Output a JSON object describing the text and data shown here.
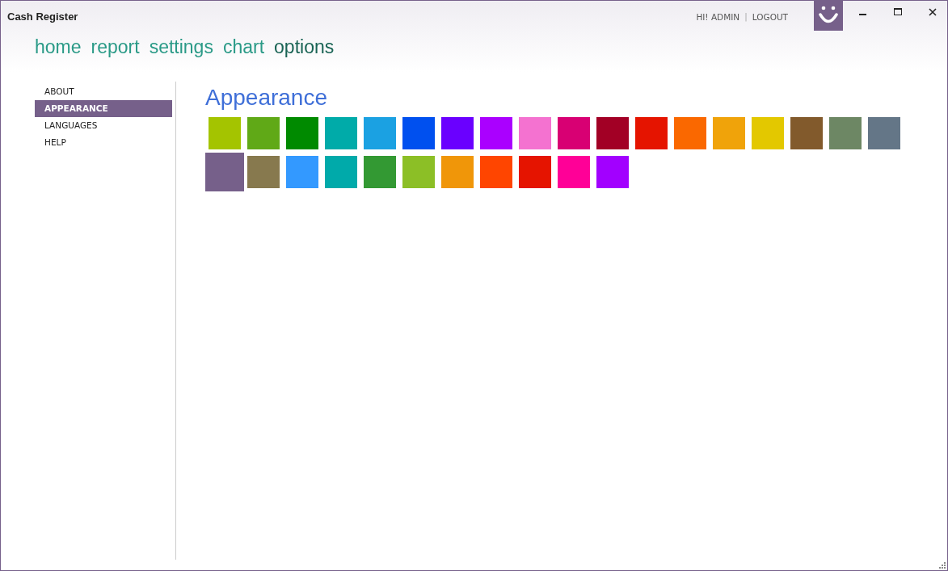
{
  "window": {
    "title": "Cash Register"
  },
  "user": {
    "greeting": "HI! ADMIN",
    "separator": "|",
    "logout": "LOGOUT"
  },
  "nav": [
    {
      "label": "home",
      "selected": false
    },
    {
      "label": "report",
      "selected": false
    },
    {
      "label": "settings",
      "selected": false
    },
    {
      "label": "chart",
      "selected": false
    },
    {
      "label": "options",
      "selected": true
    }
  ],
  "sidebar": {
    "items": [
      {
        "label": "ABOUT",
        "selected": false
      },
      {
        "label": "APPEARANCE",
        "selected": true
      },
      {
        "label": "LANGUAGES",
        "selected": false
      },
      {
        "label": "HELP",
        "selected": false
      }
    ]
  },
  "content": {
    "heading": "Appearance",
    "swatches": [
      {
        "color": "#a4c400",
        "selected": false
      },
      {
        "color": "#60a917",
        "selected": false
      },
      {
        "color": "#008a00",
        "selected": false
      },
      {
        "color": "#00aba9",
        "selected": false
      },
      {
        "color": "#1ba1e2",
        "selected": false
      },
      {
        "color": "#0050ef",
        "selected": false
      },
      {
        "color": "#6a00ff",
        "selected": false
      },
      {
        "color": "#aa00ff",
        "selected": false
      },
      {
        "color": "#f472d0",
        "selected": false
      },
      {
        "color": "#d80073",
        "selected": false
      },
      {
        "color": "#a20025",
        "selected": false
      },
      {
        "color": "#e51400",
        "selected": false
      },
      {
        "color": "#fa6800",
        "selected": false
      },
      {
        "color": "#f0a30a",
        "selected": false
      },
      {
        "color": "#e3c800",
        "selected": false
      },
      {
        "color": "#825a2c",
        "selected": false
      },
      {
        "color": "#6d8764",
        "selected": false
      },
      {
        "color": "#647687",
        "selected": false
      },
      {
        "color": "#76608a",
        "selected": true
      },
      {
        "color": "#87794e",
        "selected": false
      },
      {
        "color": "#3399ff",
        "selected": false
      },
      {
        "color": "#00aaaa",
        "selected": false
      },
      {
        "color": "#339933",
        "selected": false
      },
      {
        "color": "#8cbf26",
        "selected": false
      },
      {
        "color": "#f09609",
        "selected": false
      },
      {
        "color": "#ff4500",
        "selected": false
      },
      {
        "color": "#e51400",
        "selected": false
      },
      {
        "color": "#ff0097",
        "selected": false
      },
      {
        "color": "#a200ff",
        "selected": false
      }
    ]
  }
}
